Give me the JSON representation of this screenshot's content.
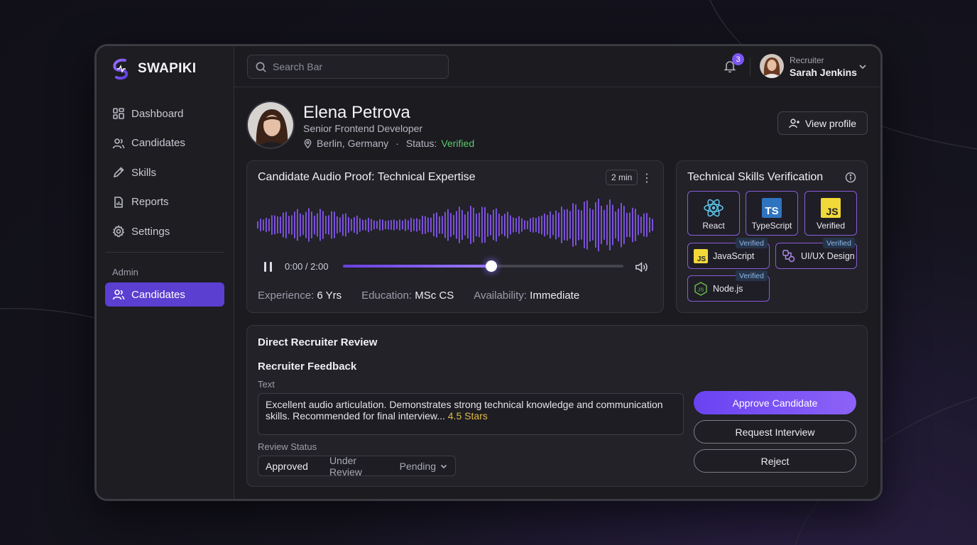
{
  "brand": {
    "name": "SWAPIKI"
  },
  "sidebar": {
    "items": [
      {
        "label": "Dashboard",
        "icon": "dashboard-icon"
      },
      {
        "label": "Candidates",
        "icon": "users-icon"
      },
      {
        "label": "Skills",
        "icon": "pencil-icon"
      },
      {
        "label": "Reports",
        "icon": "report-icon"
      },
      {
        "label": "Settings",
        "icon": "gear-icon"
      }
    ],
    "admin_label": "Admin",
    "admin_items": [
      {
        "label": "Candidates",
        "icon": "users-icon",
        "active": true
      }
    ]
  },
  "topbar": {
    "search_placeholder": "Search Bar",
    "notification_count": "3",
    "user": {
      "role": "Recruiter",
      "name": "Sarah Jenkins"
    }
  },
  "candidate": {
    "name": "Elena Petrova",
    "title": "Senior Frontend Developer",
    "location": "Berlin, Germany",
    "status_label": "Status:",
    "status_value": "Verified",
    "view_profile_label": "View profile"
  },
  "audio": {
    "title": "Candidate Audio Proof: Technical Expertise",
    "duration_chip": "2 min",
    "time": "0:00 / 2:00",
    "progress": 0.53,
    "stats": [
      {
        "label": "Experience:",
        "value": "6 Yrs"
      },
      {
        "label": "Education:",
        "value": "MSc CS"
      },
      {
        "label": "Availability:",
        "value": "Immediate"
      }
    ]
  },
  "skills": {
    "title": "Technical Skills Verification",
    "tiles": [
      {
        "label": "React",
        "icon": "react-icon"
      },
      {
        "label": "TypeScript",
        "icon": "typescript-icon",
        "icon_text": "TS"
      },
      {
        "label": "Verified",
        "icon": "javascript-icon",
        "icon_text": "JS"
      }
    ],
    "wide": [
      {
        "label": "JavaScript",
        "icon": "javascript-icon",
        "icon_text": "JS",
        "badge": "Verified"
      },
      {
        "label": "UI/UX Design",
        "icon": "design-icon",
        "badge": "Verified"
      },
      {
        "label": "Node.js",
        "icon": "nodejs-icon",
        "badge": "Verified"
      }
    ]
  },
  "review": {
    "title": "Direct Recruiter Review",
    "feedback_title": "Recruiter Feedback",
    "text_label": "Text",
    "feedback_text": "Excellent audio articulation. Demonstrates strong technical knowledge and communication skills. Recommended for final interview...",
    "stars_text": "4.5 Stars",
    "status_label": "Review Status",
    "status_options": [
      "Approved",
      "Under Review",
      "Pending"
    ],
    "buttons": {
      "approve": "Approve Candidate",
      "interview": "Request Interview",
      "reject": "Reject"
    }
  },
  "colors": {
    "accent": "#6a43f2",
    "verified": "#5dc96e",
    "stars": "#e2bb45",
    "skill_border": "#8a5bd9"
  }
}
